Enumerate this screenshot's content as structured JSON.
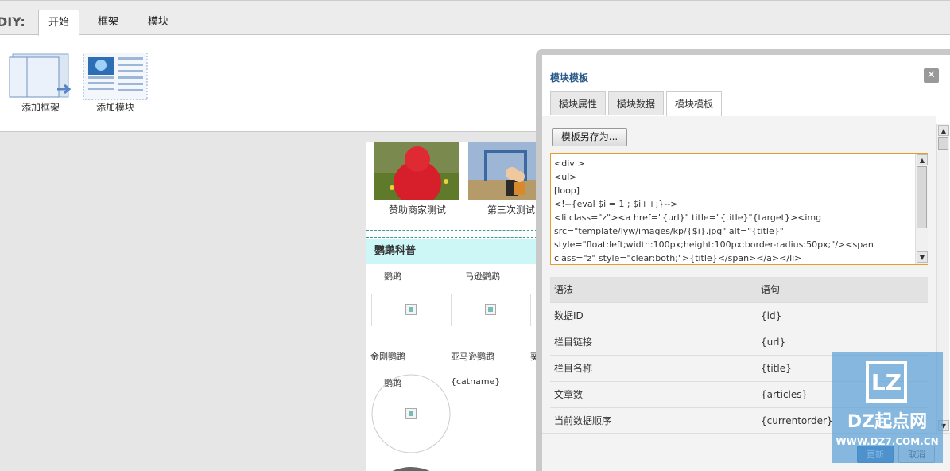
{
  "diy_toolbar": {
    "label": "DIY:",
    "tabs": [
      "开始",
      "框架",
      "模块"
    ],
    "add_frame_label": "添加框架",
    "add_module_label": "添加模块"
  },
  "preview": {
    "photo_captions": [
      "赞助商家测试",
      "第三次测试"
    ],
    "section_title": "鹦鹉科普",
    "row1": [
      "鹦鹉",
      "马逊鹦鹉"
    ],
    "row2": [
      "金刚鹦鹉",
      "亚马逊鹦鹉",
      "葵"
    ],
    "row3": [
      "鹦鹉",
      "{catname}"
    ]
  },
  "dialog": {
    "title": "模块模板",
    "close": "✕",
    "tabs": [
      "模块属性",
      "模块数据",
      "模块模板"
    ],
    "active_tab": "模块模板",
    "save_as_label": "模板另存为...",
    "code_lines": [
      "<div >",
      "<ul>",
      "[loop]",
      "<!--{eval  $i = 1 ; $i++;}-->",
      "<li class=\"z\"><a href=\"{url}\" title=\"{title}\"{target}><img",
      "src=\"template/lyw/images/kp/{$i}.jpg\" alt=\"{title}\"",
      "style=\"float:left;width:100px;height:100px;border-radius:50px;\"/><span",
      "class=\"z\" style=\"clear:both;\">{title}</span></a></li>"
    ],
    "syntax_header": [
      "语法",
      "语句"
    ],
    "syntax_rows": [
      [
        "数据ID",
        "{id}"
      ],
      [
        "栏目链接",
        "{url}"
      ],
      [
        "栏目名称",
        "{title}"
      ],
      [
        "文章数",
        "{articles}"
      ],
      [
        "当前数据顺序",
        "{currentorder}"
      ]
    ],
    "footer_buttons": [
      "更新",
      "取消"
    ]
  },
  "watermark": {
    "logo": "LZ",
    "name": "DZ起点网",
    "url": "WWW.DZ7.COM.CN"
  },
  "colors": {
    "accent_blue": "#2a5a8a",
    "section_bg": "#cdf7f7",
    "code_border": "#e89a2c",
    "watermark_bg": "#5aa0d7"
  }
}
